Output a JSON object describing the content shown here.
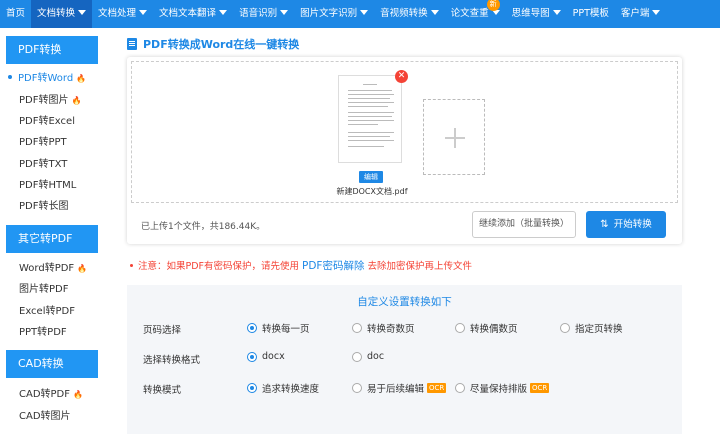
{
  "topnav": {
    "items": [
      {
        "label": "首页",
        "dropdown": false
      },
      {
        "label": "文档转换",
        "dropdown": true
      },
      {
        "label": "文档处理",
        "dropdown": true
      },
      {
        "label": "文档文本翻译",
        "dropdown": true
      },
      {
        "label": "语音识别",
        "dropdown": true
      },
      {
        "label": "图片文字识别",
        "dropdown": true
      },
      {
        "label": "音视频转换",
        "dropdown": true
      },
      {
        "label": "论文查重",
        "dropdown": true,
        "badge": "新"
      },
      {
        "label": "思维导图",
        "dropdown": true
      },
      {
        "label": "PPT模板",
        "dropdown": false
      },
      {
        "label": "客户端",
        "dropdown": true
      }
    ]
  },
  "sidebar": {
    "sections": [
      {
        "title": "PDF转换",
        "items": [
          {
            "label": "PDF转Word",
            "hot": true,
            "active": true
          },
          {
            "label": "PDF转图片",
            "hot": true
          },
          {
            "label": "PDF转Excel"
          },
          {
            "label": "PDF转PPT"
          },
          {
            "label": "PDF转TXT"
          },
          {
            "label": "PDF转HTML"
          },
          {
            "label": "PDF转长图"
          }
        ]
      },
      {
        "title": "其它转PDF",
        "items": [
          {
            "label": "Word转PDF",
            "hot": true
          },
          {
            "label": "图片转PDF"
          },
          {
            "label": "Excel转PDF"
          },
          {
            "label": "PPT转PDF"
          }
        ]
      },
      {
        "title": "CAD转换",
        "items": [
          {
            "label": "CAD转PDF",
            "hot": true
          },
          {
            "label": "CAD转图片"
          }
        ]
      }
    ]
  },
  "main": {
    "title": "PDF转换成Word在线一键转换",
    "file": {
      "name": "新建DOCX文档.pdf",
      "edit_label": "编辑",
      "remove_icon": "close-icon"
    },
    "upload_status": "已上传1个文件，共186.44K。",
    "continue_button": "继续添加（批量转换）",
    "start_button": "开始转换",
    "notice": {
      "prefix": "注意：如果PDF有密码保护，请先使用",
      "link": "PDF密码解除",
      "suffix": "去除加密保护再上传文件"
    }
  },
  "settings": {
    "title": "自定义设置转换如下",
    "rows": [
      {
        "label": "页码选择",
        "options": [
          {
            "label": "转换每一页",
            "selected": true
          },
          {
            "label": "转换奇数页"
          },
          {
            "label": "转换偶数页"
          },
          {
            "label": "指定页转换"
          }
        ]
      },
      {
        "label": "选择转换格式",
        "options": [
          {
            "label": "docx",
            "selected": true
          },
          {
            "label": "doc"
          }
        ]
      },
      {
        "label": "转换模式",
        "options": [
          {
            "label": "追求转换速度",
            "selected": true
          },
          {
            "label": "易于后续编辑",
            "badge": "OCR"
          },
          {
            "label": "尽量保持排版",
            "badge": "OCR"
          }
        ]
      }
    ]
  },
  "colors": {
    "accent": "#1e88e5",
    "sidebar_head": "#2196f3",
    "warning": "#f44336",
    "ocr": "#ff9800"
  }
}
